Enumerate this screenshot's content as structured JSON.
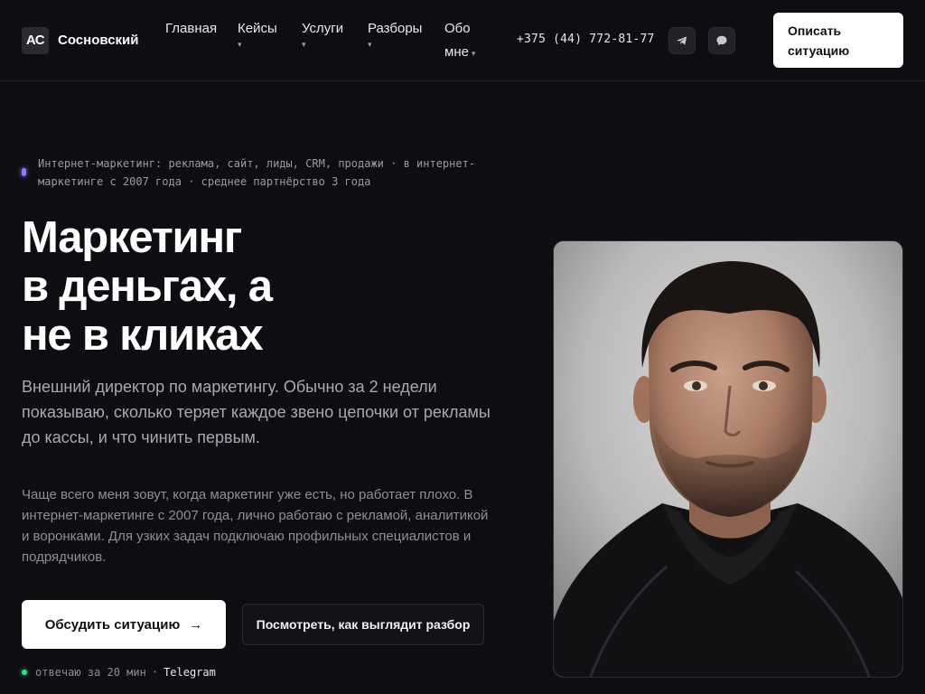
{
  "header": {
    "logo_initials": "АС",
    "logo_name": "Сосновский",
    "nav": [
      {
        "label": "Главная",
        "has_caret": false
      },
      {
        "label": "Кейсы",
        "has_caret": true
      },
      {
        "label": "Услуги",
        "has_caret": true
      },
      {
        "label": "Разборы",
        "has_caret": true
      },
      {
        "label_line1": "Обо",
        "label_line2": "мне",
        "has_caret": true
      }
    ],
    "phone": "+375 (44) 772-81-77",
    "cta": "Описать ситуацию"
  },
  "hero": {
    "eyebrow": "Интернет-маркетинг: реклама, сайт, лиды, CRM, продажи · в интернет-маркетинге с 2007 года · среднее партнёрство 3 года",
    "headline": [
      "Маркетинг",
      "в деньгах, а",
      "не в кликах"
    ],
    "lead": "Внешний директор по маркетингу. Обычно за 2 недели показываю, сколько теряет каждое звено цепочки от рекламы до кассы, и что чинить первым.",
    "body": "Чаще всего меня зовут, когда маркетинг уже есть, но работает плохо. В интернет-маркетинге с 2007 года, лично работаю с рекламой, аналитикой и воронками. Для узких задач подключаю профильных специалистов и подрядчиков.",
    "primary_button": "Обсудить ситуацию",
    "primary_arrow": "→",
    "secondary_button": "Посмотреть, как выглядит разбор",
    "status_text": "отвечаю за 20 мин",
    "status_sep": "·",
    "status_channel": "Telegram"
  },
  "colors": {
    "background": "#0e0d12",
    "accent_dot": "#8b7cf6",
    "online": "#3ddc84",
    "button_bg": "#ffffff"
  },
  "icons": {
    "telegram": "telegram-icon",
    "chat": "chat-bubble-icon",
    "caret": "caret-down-icon"
  }
}
